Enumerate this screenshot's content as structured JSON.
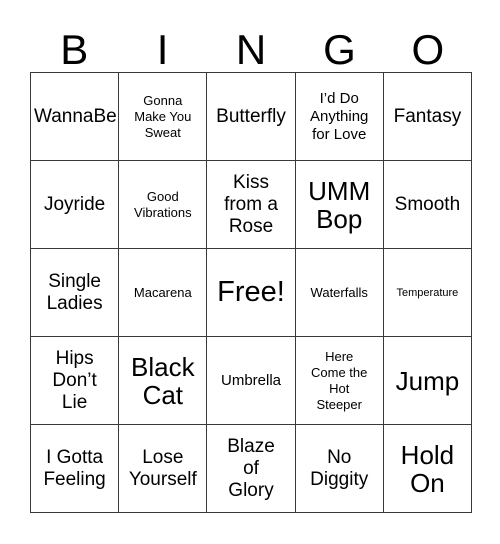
{
  "card": {
    "title": "Bingo Card",
    "header_letters": [
      "B",
      "I",
      "N",
      "G",
      "O"
    ],
    "columns": 5,
    "rows": 5,
    "free_space": "Free!",
    "colors": {
      "background": "#ffffff",
      "text": "#000000",
      "grid_line": "#3a3a3a"
    },
    "squares": [
      [
        {
          "text": "WannaBe",
          "size": "md",
          "free": false
        },
        {
          "text": "Gonna\nMake You\nSweat",
          "size": "xs",
          "free": false
        },
        {
          "text": "Butterfly",
          "size": "md",
          "free": false
        },
        {
          "text": "I’d Do\nAnything\nfor Love",
          "size": "sm",
          "free": false
        },
        {
          "text": "Fantasy",
          "size": "md",
          "free": false
        }
      ],
      [
        {
          "text": "Joyride",
          "size": "md",
          "free": false
        },
        {
          "text": "Good\nVibrations",
          "size": "xs",
          "free": false
        },
        {
          "text": "Kiss\nfrom a\nRose",
          "size": "md",
          "free": false
        },
        {
          "text": "UMM\nBop",
          "size": "lg",
          "free": false
        },
        {
          "text": "Smooth",
          "size": "md",
          "free": false
        }
      ],
      [
        {
          "text": "Single\nLadies",
          "size": "md",
          "free": false
        },
        {
          "text": "Macarena",
          "size": "xs",
          "free": false
        },
        {
          "text": "Free!",
          "size": "xl",
          "free": true
        },
        {
          "text": "Waterfalls",
          "size": "xs",
          "free": false
        },
        {
          "text": "Temperature",
          "size": "xxs",
          "free": false
        }
      ],
      [
        {
          "text": "Hips\nDon’t\nLie",
          "size": "md",
          "free": false
        },
        {
          "text": "Black\nCat",
          "size": "lg",
          "free": false
        },
        {
          "text": "Umbrella",
          "size": "sm",
          "free": false
        },
        {
          "text": "Here\nCome the\nHot\nSteeper",
          "size": "xs",
          "free": false
        },
        {
          "text": "Jump",
          "size": "lg",
          "free": false
        }
      ],
      [
        {
          "text": "I Gotta\nFeeling",
          "size": "md",
          "free": false
        },
        {
          "text": "Lose\nYourself",
          "size": "md",
          "free": false
        },
        {
          "text": "Blaze\nof\nGlory",
          "size": "md",
          "free": false
        },
        {
          "text": "No\nDiggity",
          "size": "md",
          "free": false
        },
        {
          "text": "Hold\nOn",
          "size": "lg",
          "free": false
        }
      ]
    ]
  }
}
